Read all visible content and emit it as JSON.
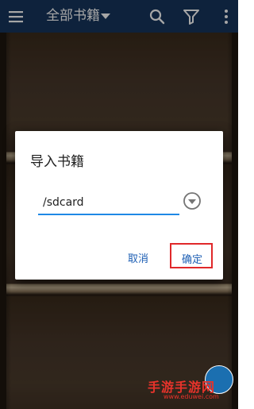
{
  "app_bar": {
    "title": "全部书籍",
    "icons": {
      "menu": "hamburger-menu-icon",
      "dropdown": "caret-down-icon",
      "search": "search-icon",
      "filter": "filter-funnel-icon",
      "more": "more-vert-icon"
    },
    "background_color": "#16355d"
  },
  "dialog": {
    "title": "导入书籍",
    "path_value": "/sdcard",
    "path_placeholder": "",
    "dropdown_icon": "circle-chevron-down-icon",
    "cancel_label": "取消",
    "confirm_label": "确定",
    "accent_color": "#1e88e5",
    "button_text_color": "#1e5fb4",
    "highlight_color": "#e0282a"
  },
  "watermark": {
    "text": "手游手游网",
    "url": "www.eduwei.com",
    "color": "#e8332b"
  }
}
